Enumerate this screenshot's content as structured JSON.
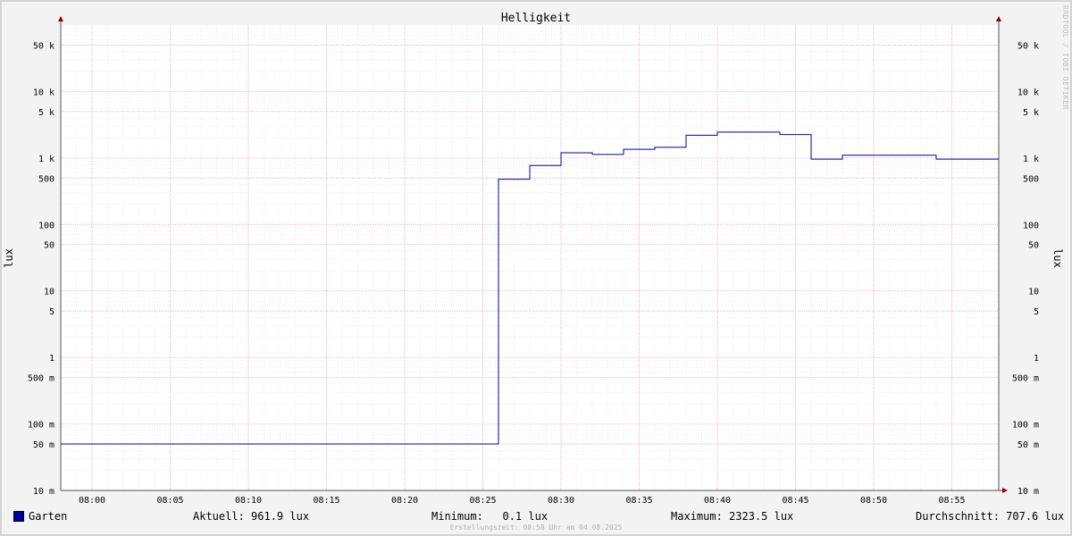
{
  "chart_data": {
    "type": "line",
    "title": "Helligkeit",
    "ylabel": "lux",
    "y_scale": "log",
    "ylim": [
      0.01,
      100000
    ],
    "grid": true,
    "x_ticks": [
      "08:00",
      "08:05",
      "08:10",
      "08:15",
      "08:20",
      "08:25",
      "08:30",
      "08:35",
      "08:40",
      "08:45",
      "08:50",
      "08:55"
    ],
    "y_ticks": [
      {
        "value": 0.01,
        "label": "10 m"
      },
      {
        "value": 0.05,
        "label": "50 m"
      },
      {
        "value": 0.1,
        "label": "100 m"
      },
      {
        "value": 0.5,
        "label": "500 m"
      },
      {
        "value": 1,
        "label": "1"
      },
      {
        "value": 5,
        "label": "5"
      },
      {
        "value": 10,
        "label": "10"
      },
      {
        "value": 50,
        "label": "50"
      },
      {
        "value": 100,
        "label": "100"
      },
      {
        "value": 500,
        "label": "500"
      },
      {
        "value": 1000,
        "label": "1 k"
      },
      {
        "value": 5000,
        "label": "5 k"
      },
      {
        "value": 10000,
        "label": "10 k"
      },
      {
        "value": 50000,
        "label": "50 k"
      }
    ],
    "series": [
      {
        "name": "Garten",
        "color": "#00009c",
        "step": true,
        "x": [
          "07:58",
          "08:26",
          "08:28",
          "08:30",
          "08:32",
          "08:34",
          "08:36",
          "08:38",
          "08:40",
          "08:42",
          "08:44",
          "08:46",
          "08:48",
          "08:50",
          "08:52",
          "08:54",
          "08:58"
        ],
        "values": [
          0.05,
          480,
          770,
          1200,
          1130,
          1350,
          1450,
          2200,
          2450,
          2450,
          2250,
          960,
          1100,
          1100,
          1100,
          960,
          960
        ]
      }
    ]
  },
  "legend": {
    "name": "Garten",
    "color": "#00009c",
    "current": "Aktuell: 961.9 lux",
    "minimum": "Minimum:   0.1 lux",
    "maximum": "Maximum: 2323.5 lux",
    "average": "Durchschnitt: 707.6 lux"
  },
  "footer": "Erstellungszeit: 08:58 Uhr am 04.08.2025",
  "watermark": "RRDTOOL / TOBI OETIKER",
  "colors": {
    "background": "#f3f3f3",
    "plot": "#ffffff",
    "major_grid": "#e6a8b8",
    "minor_grid": "#d8d8d8",
    "axis": "#555555",
    "arrow": "#8b0000"
  }
}
